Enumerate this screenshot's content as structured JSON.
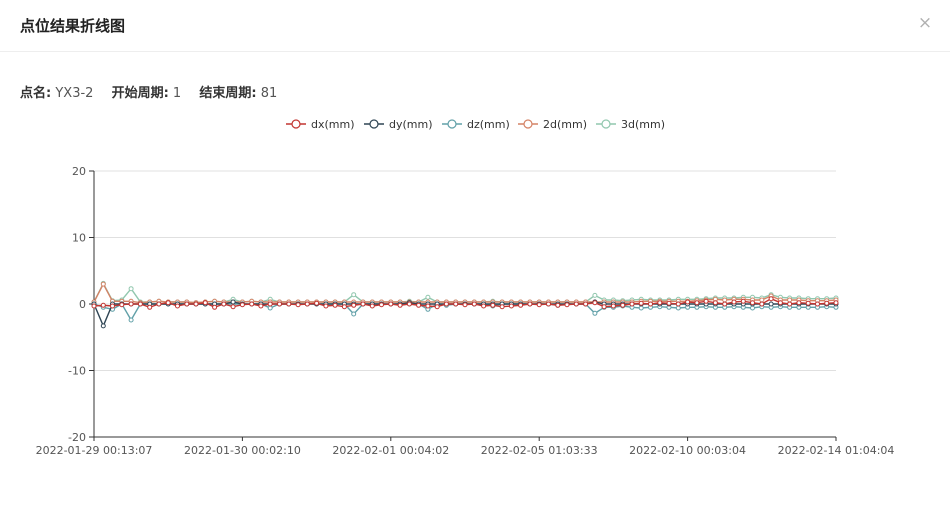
{
  "dialog": {
    "title": "点位结果折线图",
    "close_glyph": "×"
  },
  "info": {
    "point_label": "点名:",
    "point_value": "YX3-2",
    "start_label": "开始周期:",
    "start_value": "1",
    "end_label": "结束周期:",
    "end_value": "81"
  },
  "chart_data": {
    "type": "line",
    "ylim": [
      -20,
      20
    ],
    "yticks": [
      "20",
      "10",
      "0",
      "-10",
      "-20"
    ],
    "xticks": [
      "2022-01-29 00:13:07",
      "2022-01-30 00:02:10",
      "2022-02-01 00:04:02",
      "2022-02-05 01:03:33",
      "2022-02-10 00:03:04",
      "2022-02-14 01:04:04"
    ],
    "grid": true,
    "legend_position": "top-center",
    "series": [
      {
        "name": "dx(mm)",
        "color": "#c23531",
        "values": [
          -0.3,
          -0.2,
          -0.3,
          -0.1,
          0,
          0,
          -0.5,
          0,
          0.2,
          -0.3,
          0,
          0,
          0.2,
          -0.5,
          0,
          -0.4,
          -0.1,
          0,
          -0.3,
          0,
          0,
          0,
          -0.1,
          0,
          0.1,
          -0.3,
          -0.2,
          -0.4,
          -0.2,
          0,
          -0.3,
          -0.1,
          0,
          -0.2,
          0,
          -0.2,
          -0.3,
          -0.4,
          0,
          0,
          -0.1,
          0,
          -0.3,
          -0.2,
          -0.4,
          -0.3,
          -0.2,
          0,
          -0.1,
          0,
          -0.2,
          -0.1,
          0,
          0,
          0.2,
          -0.4,
          -0.3,
          -0.2,
          0,
          0.1,
          0,
          0.2,
          0.1,
          0,
          0.3,
          0.2,
          0.4,
          0.2,
          0,
          0.3,
          0.4,
          0.2,
          0,
          0.8,
          0.2,
          0,
          0.2,
          0.1,
          0,
          0.1,
          0.2
        ]
      },
      {
        "name": "dy(mm)",
        "color": "#2f4554",
        "values": [
          0,
          -3.3,
          0,
          0,
          0,
          0,
          0,
          0,
          0,
          0,
          0,
          0,
          0,
          0,
          0,
          0.3,
          0,
          0,
          0,
          0,
          0,
          0,
          0,
          0,
          0,
          0,
          0,
          0,
          0,
          0,
          0,
          0,
          0,
          0,
          0.2,
          0,
          0,
          0,
          0,
          0,
          0,
          0,
          0,
          0,
          0,
          0,
          0,
          0,
          0,
          0,
          0,
          0,
          0,
          0,
          0.3,
          0,
          0,
          0,
          0,
          0,
          0,
          0,
          0,
          0,
          0,
          0,
          0,
          0,
          0,
          0,
          0,
          0,
          0,
          0,
          0,
          0,
          0,
          0,
          0,
          0,
          0
        ]
      },
      {
        "name": "dz(mm)",
        "color": "#61a0a8",
        "values": [
          0,
          -0.5,
          -0.8,
          0,
          -2.4,
          0,
          0,
          0,
          0,
          0,
          0,
          0,
          0,
          0,
          0,
          0,
          0,
          0,
          0,
          -0.6,
          0,
          0,
          0,
          0,
          0,
          0,
          0,
          0,
          -1.5,
          0,
          0,
          0,
          0,
          0,
          0,
          0,
          -0.8,
          0,
          -0.2,
          0,
          0,
          0,
          0,
          -0.3,
          0,
          0,
          0,
          0,
          0,
          0,
          -0.2,
          0,
          0,
          0,
          -1.4,
          -0.5,
          -0.5,
          -0.3,
          -0.5,
          -0.6,
          -0.5,
          -0.4,
          -0.5,
          -0.6,
          -0.5,
          -0.5,
          -0.4,
          -0.5,
          -0.5,
          -0.4,
          -0.5,
          -0.6,
          -0.4,
          -0.5,
          -0.4,
          -0.5,
          -0.5,
          -0.5,
          -0.5,
          -0.4,
          -0.5
        ]
      },
      {
        "name": "2d(mm)",
        "color": "#d48265",
        "values": [
          0.3,
          3.0,
          0.4,
          0.4,
          0.4,
          0.2,
          0.3,
          0.4,
          0.3,
          0.3,
          0.3,
          0.2,
          0.3,
          0.4,
          0.3,
          0.3,
          0.3,
          0.4,
          0.3,
          0.3,
          0.3,
          0.3,
          0.3,
          0.3,
          0.3,
          0.3,
          0.3,
          0.3,
          0.3,
          0.3,
          0.3,
          0.3,
          0.3,
          0.3,
          0.3,
          0.3,
          0.3,
          0.3,
          0.3,
          0.3,
          0.3,
          0.3,
          0.3,
          0.3,
          0.3,
          0.3,
          0.3,
          0.3,
          0.3,
          0.3,
          0.3,
          0.3,
          0.3,
          0.3,
          0.3,
          0.3,
          0.3,
          0.3,
          0.3,
          0.4,
          0.4,
          0.4,
          0.4,
          0.4,
          0.4,
          0.5,
          0.6,
          0.7,
          0.6,
          0.7,
          0.7,
          0.6,
          0.6,
          1.2,
          0.6,
          0.6,
          0.6,
          0.5,
          0.5,
          0.5,
          0.6
        ]
      },
      {
        "name": "3d(mm)",
        "color": "#91c7ae",
        "values": [
          0.3,
          3.1,
          0.5,
          0.6,
          2.3,
          0.3,
          0.3,
          0.4,
          0.3,
          0.3,
          0.3,
          0.2,
          0.3,
          0.4,
          0.3,
          0.7,
          0.3,
          0.4,
          0.3,
          0.7,
          0.3,
          0.3,
          0.3,
          0.3,
          0.3,
          0.3,
          0.3,
          0.3,
          1.4,
          0.3,
          0.3,
          0.3,
          0.3,
          0.3,
          0.4,
          0.3,
          1.0,
          0.3,
          0.3,
          0.3,
          0.3,
          0.3,
          0.3,
          0.4,
          0.3,
          0.3,
          0.3,
          0.3,
          0.3,
          0.3,
          0.3,
          0.3,
          0.3,
          0.3,
          1.3,
          0.6,
          0.6,
          0.5,
          0.6,
          0.7,
          0.6,
          0.6,
          0.6,
          0.7,
          0.7,
          0.7,
          0.8,
          0.9,
          0.9,
          0.9,
          1.0,
          1.0,
          0.9,
          1.4,
          1.0,
          0.9,
          0.9,
          0.8,
          0.8,
          0.8,
          0.9
        ]
      }
    ]
  }
}
